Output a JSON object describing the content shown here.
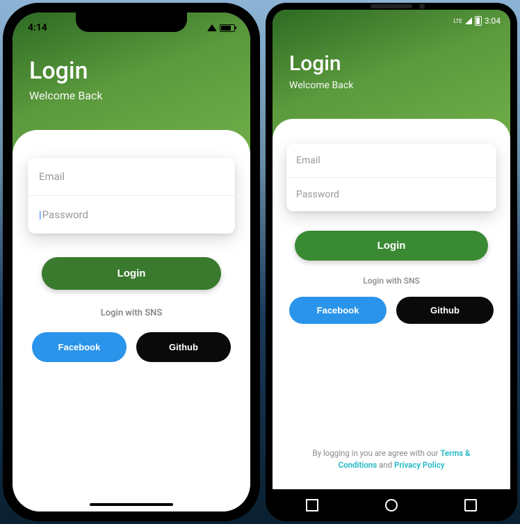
{
  "ios": {
    "status": {
      "time": "4:14"
    },
    "header": {
      "title": "Login",
      "subtitle": "Welcome Back"
    },
    "inputs": {
      "email_placeholder": "Email",
      "password_placeholder": "Password"
    },
    "login_button": "Login",
    "sns_label": "Login with SNS",
    "facebook_button": "Facebook",
    "github_button": "Github"
  },
  "android": {
    "status": {
      "time": "3:04",
      "lte": "LTE"
    },
    "header": {
      "title": "Login",
      "subtitle": "Welcome Back"
    },
    "inputs": {
      "email_placeholder": "Email",
      "password_placeholder": "Password"
    },
    "login_button": "Login",
    "sns_label": "Login with SNS",
    "facebook_button": "Facebook",
    "github_button": "Github",
    "disclaimer": {
      "prefix": "By logging in you are agree with our ",
      "terms": "Terms & Conditions",
      "mid": "  and ",
      "privacy": "Privacy Policy"
    }
  }
}
